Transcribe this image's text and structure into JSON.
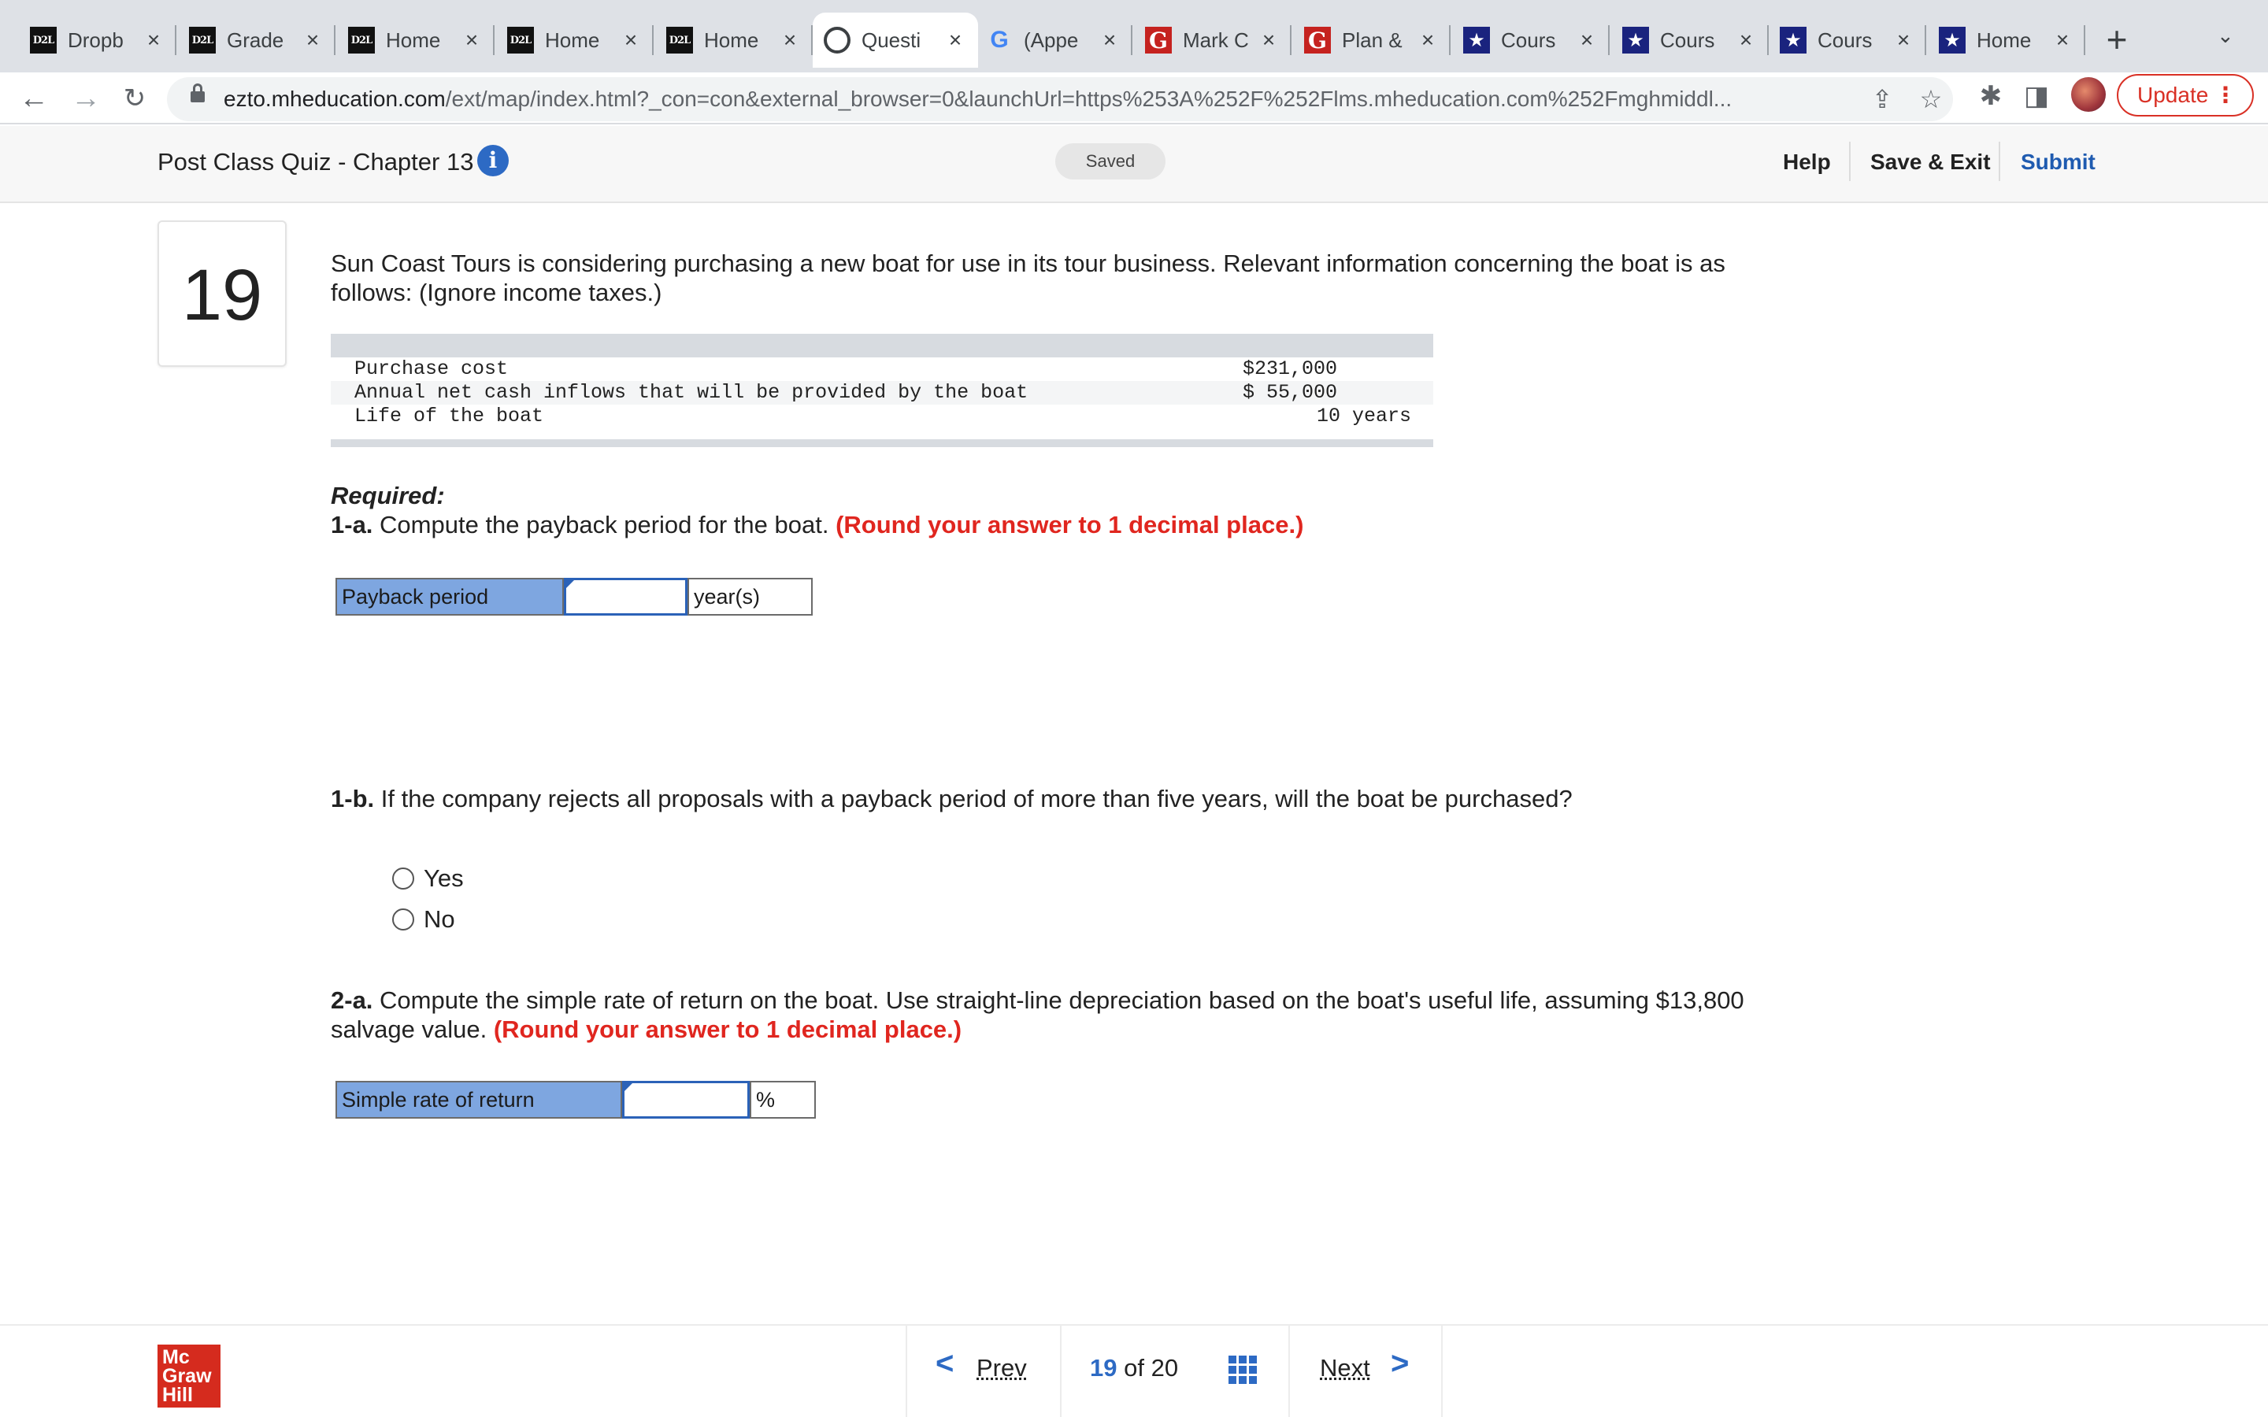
{
  "browser": {
    "tabs": [
      {
        "favicon": "d2l-icon",
        "title": "Dropb",
        "active": false
      },
      {
        "favicon": "d2l-icon",
        "title": "Grade",
        "active": false
      },
      {
        "favicon": "d2l-icon",
        "title": "Home",
        "active": false
      },
      {
        "favicon": "d2l-icon",
        "title": "Home",
        "active": false
      },
      {
        "favicon": "d2l-icon",
        "title": "Home",
        "active": false
      },
      {
        "favicon": "globe-icon",
        "title": "Questi",
        "active": true
      },
      {
        "favicon": "google-icon",
        "title": "(Appe",
        "active": false
      },
      {
        "favicon": "g-red-icon",
        "title": "Mark C",
        "active": false
      },
      {
        "favicon": "g-red-icon",
        "title": "Plan &",
        "active": false
      },
      {
        "favicon": "star-icon",
        "title": "Cours",
        "active": false
      },
      {
        "favicon": "star-icon",
        "title": "Cours",
        "active": false
      },
      {
        "favicon": "star-icon",
        "title": "Cours",
        "active": false
      },
      {
        "favicon": "star-icon",
        "title": "Home",
        "active": false
      }
    ],
    "new_tab": "+",
    "url_host": "ezto.mheducation.com",
    "url_path": "/ext/map/index.html?_con=con&external_browser=0&launchUrl=https%253A%252F%252Flms.mheducation.com%252Fmghmiddl...",
    "update_label": "Update"
  },
  "header": {
    "quiz_title": "Post Class Quiz - Chapter 13",
    "saved_label": "Saved",
    "help_label": "Help",
    "save_exit_label": "Save & Exit",
    "submit_label": "Submit"
  },
  "question": {
    "number": "19",
    "intro": "Sun Coast Tours is considering purchasing a new boat for use in its tour business. Relevant information concerning the boat is as follows: (Ignore income taxes.)",
    "table": [
      {
        "label": "Purchase cost",
        "value": "$231,000"
      },
      {
        "label": "Annual net cash inflows that will be provided by the boat",
        "value": "$ 55,000"
      },
      {
        "label": "Life of the boat",
        "value": "10 years"
      }
    ],
    "required_label": "Required:",
    "part_1a": {
      "tag": "1-a.",
      "text": "Compute the payback period for the boat.",
      "note": "(Round your answer to 1 decimal place.)",
      "field_label": "Payback period",
      "field_value": "",
      "unit": "year(s)"
    },
    "part_1b": {
      "tag": "1-b.",
      "text": "If the company rejects all proposals with a payback period of more than five years, will the boat be purchased?",
      "options": [
        "Yes",
        "No"
      ]
    },
    "part_2a": {
      "tag": "2-a.",
      "text": "Compute the simple rate of return on the boat. Use straight-line depreciation based on the boat's useful life, assuming $13,800 salvage value.",
      "note": "(Round your answer to 1 decimal place.)",
      "field_label": "Simple rate of return",
      "field_value": "",
      "unit": "%"
    }
  },
  "footer": {
    "logo_lines": [
      "Mc",
      "Graw",
      "Hill"
    ],
    "prev_label": "Prev",
    "current_page": "19",
    "of_label": "of",
    "total_pages": "20",
    "next_label": "Next"
  }
}
